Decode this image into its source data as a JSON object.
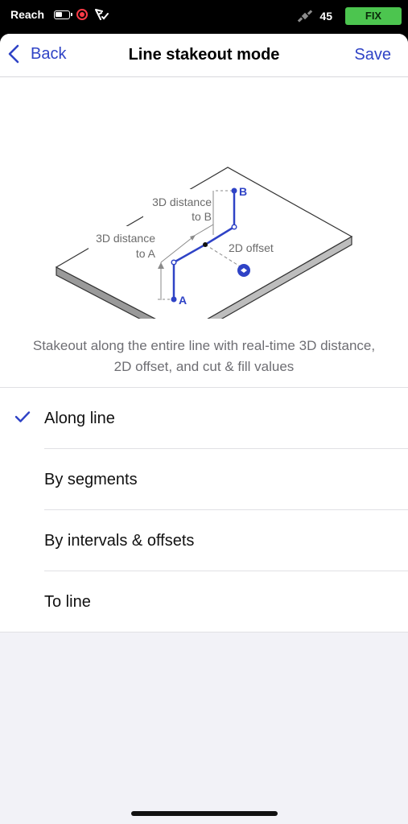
{
  "status_bar": {
    "device_name": "Reach",
    "satellite_count": "45",
    "fix_status": "FIX",
    "fix_color": "#4cc54f"
  },
  "nav": {
    "back_label": "Back",
    "title": "Line stakeout mode",
    "save_label": "Save",
    "accent_color": "#2f43c6"
  },
  "illustration": {
    "label_3d_to_b_line1": "3D distance",
    "label_3d_to_b_line2": "to B",
    "label_3d_to_a_line1": "3D distance",
    "label_3d_to_a_line2": "to A",
    "label_2d_offset": "2D offset",
    "point_a": "A",
    "point_b": "B"
  },
  "description": "Stakeout along the entire line with real-time 3D distance, 2D offset, and cut & fill values",
  "options": [
    {
      "label": "Along line",
      "selected": true
    },
    {
      "label": "By segments",
      "selected": false
    },
    {
      "label": "By intervals & offsets",
      "selected": false
    },
    {
      "label": "To line",
      "selected": false
    }
  ]
}
